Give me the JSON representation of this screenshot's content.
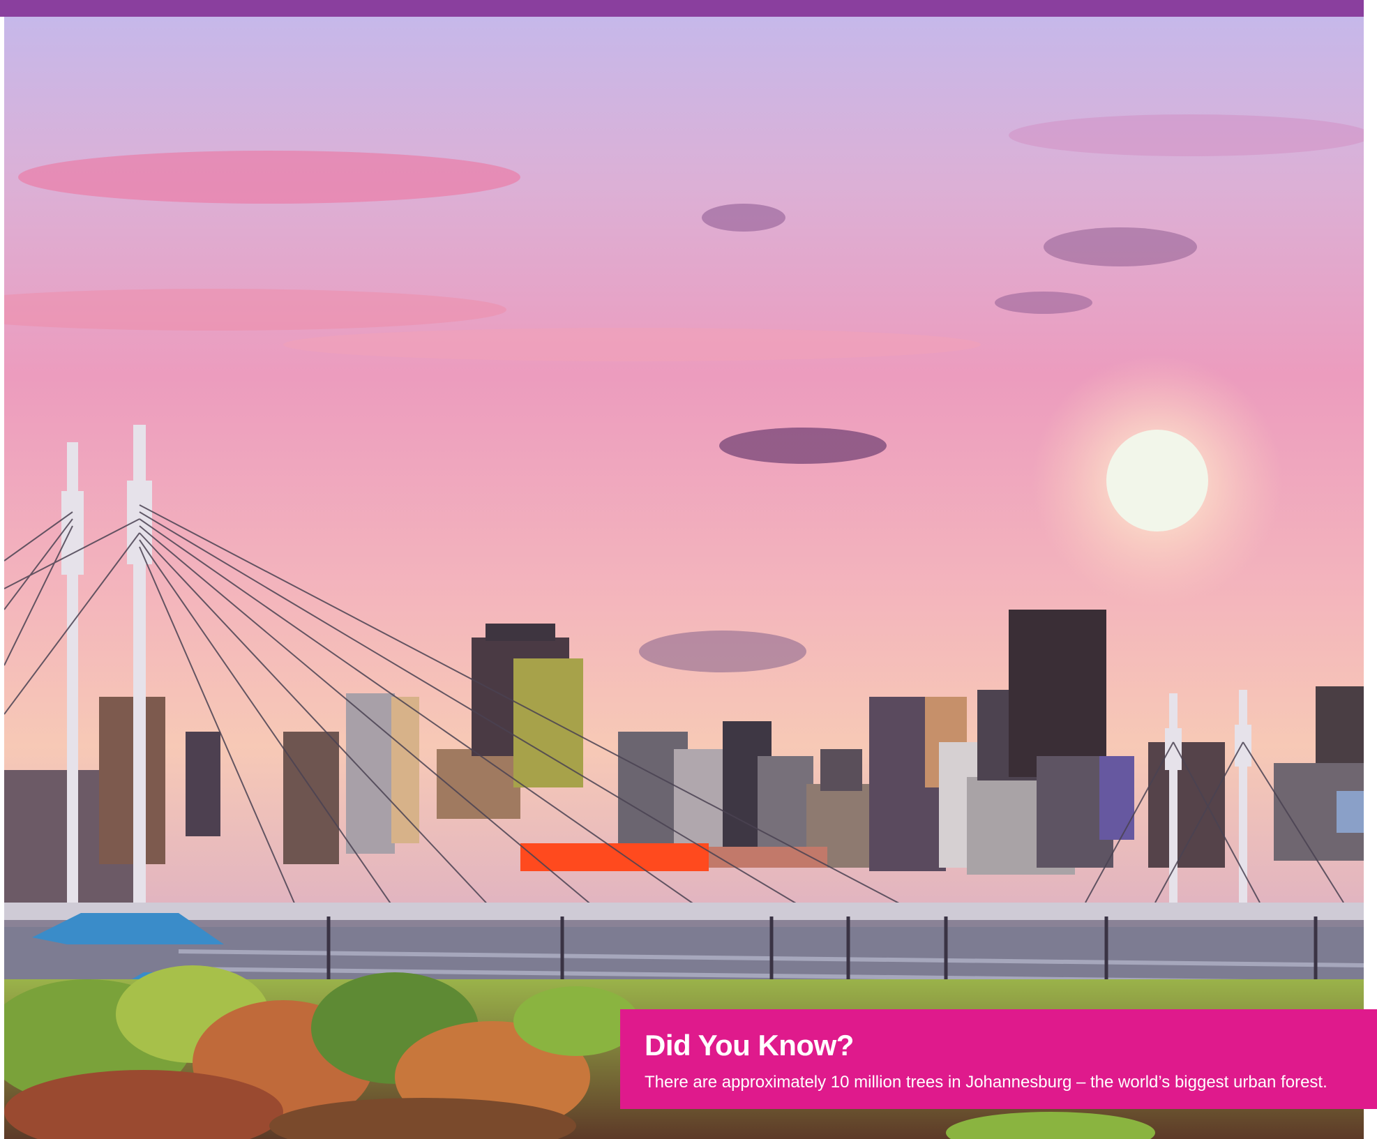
{
  "callout": {
    "title": "Did You Know?",
    "body": "There are approximately 10 million trees in Johannesburg – the world’s biggest urban forest."
  },
  "colors": {
    "top_bar": "#8a3f9e",
    "callout_background": "#df1a8c",
    "callout_text": "#ffffff"
  }
}
